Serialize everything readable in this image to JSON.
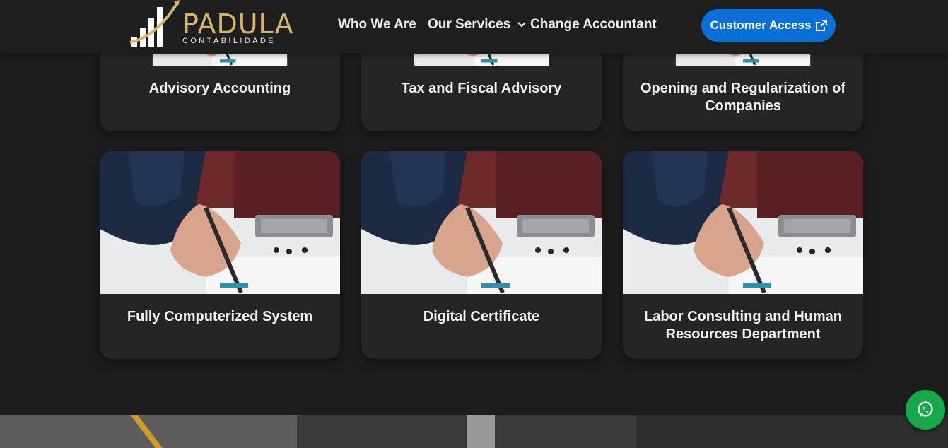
{
  "brand": {
    "name": "PADULA",
    "tagline": "CONTABILIDADE",
    "gold": "#d6b56a"
  },
  "nav": {
    "items": [
      {
        "label": "Who We Are"
      },
      {
        "label": "Our Services",
        "has_dropdown": true,
        "icon": "chevron-down-icon"
      },
      {
        "label": "Change Accountant"
      }
    ],
    "cta": {
      "label": "Customer Access",
      "icon": "external-link-icon",
      "color": "#0a6fd6"
    }
  },
  "services": [
    {
      "title": "Advisory Accounting"
    },
    {
      "title": "Tax and Fiscal Advisory"
    },
    {
      "title": "Opening and Regularization of Companies"
    },
    {
      "title": "Fully Computerized System"
    },
    {
      "title": "Digital Certificate"
    },
    {
      "title": "Labor Consulting and Human Resources Department"
    }
  ],
  "whatsapp": {
    "icon": "whatsapp-icon",
    "color": "#17a84a"
  }
}
